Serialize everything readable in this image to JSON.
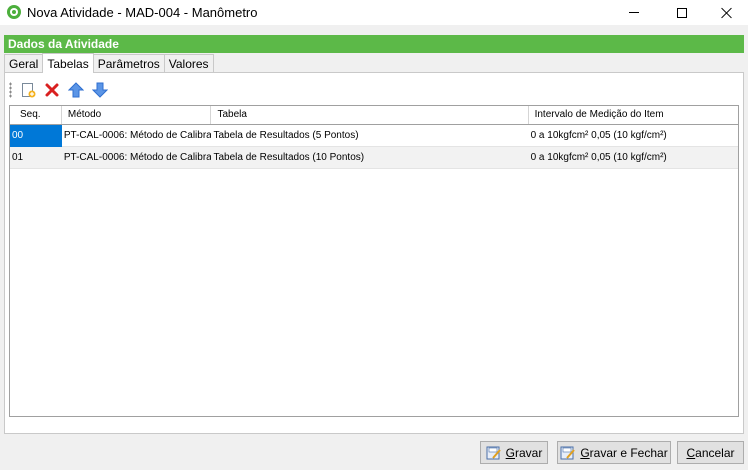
{
  "window": {
    "title": "Nova Atividade - MAD-004 - Manômetro",
    "controls": [
      "minimize-icon",
      "maximize-icon",
      "close-icon"
    ]
  },
  "section": {
    "title": "Dados da Atividade"
  },
  "tabs": [
    {
      "label": "Geral",
      "active": false
    },
    {
      "label": "Tabelas",
      "active": true
    },
    {
      "label": "Parâmetros",
      "active": false
    },
    {
      "label": "Valores",
      "active": false
    }
  ],
  "toolbar": {
    "icons": [
      "new-icon",
      "delete-icon",
      "move-up-icon",
      "move-down-icon"
    ]
  },
  "grid": {
    "columns": [
      "Seq.",
      "Método",
      "Tabela",
      "Intervalo de Medição do Item"
    ],
    "rows": [
      {
        "seq": "00",
        "metodo": "PT-CAL-0006: Método de Calibra...",
        "tabela": "Tabela de Resultados (5 Pontos)",
        "intervalo": "0 a 10kgfcm² 0,05 (10 kgf/cm²)"
      },
      {
        "seq": "01",
        "metodo": "PT-CAL-0006: Método de Calibra...",
        "tabela": "Tabela de Resultados (10 Pontos)",
        "intervalo": "0 a 10kgfcm² 0,05 (10 kgf/cm²)"
      }
    ]
  },
  "buttons": {
    "gravar_first": "G",
    "gravar_rest": "ravar",
    "gravar_fechar_first": "G",
    "gravar_fechar_rest": "ravar e Fechar",
    "cancelar_first": "C",
    "cancelar_rest": "ancelar"
  },
  "colors": {
    "header_green": "#5cb948",
    "selection_blue": "#0078d7",
    "delete_red": "#d92020",
    "arrow_blue": "#2f6fd0"
  }
}
